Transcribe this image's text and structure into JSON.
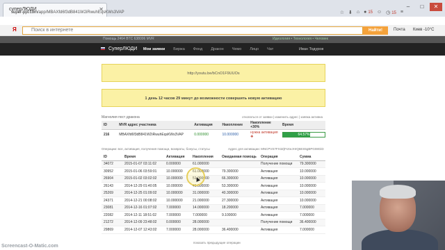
{
  "browser": {
    "tab_title": "суперЛЮДИ",
    "url_host": "super-ppl.com",
    "url_path": "/app/MBAXfd6f3dB841W2iRwuhEqsKWs3VAP",
    "notification_count": "15",
    "clock": "15",
    "search_placeholder": "Поиск в интернете",
    "search_button": "Найти!",
    "mail_link": "Почта",
    "city_link": "Киев -10°C"
  },
  "app": {
    "info_left": "Помощь  2464 BTC  638006 MVR",
    "info_right": "Идеология • Технология • Человек",
    "brand": "СуперЛЮДИ",
    "nav": [
      "Мои заявки",
      "Биржа",
      "Фонд",
      "Дракон",
      "Чемо",
      "Лицо",
      "Чат"
    ],
    "user": "Иван Тодуров"
  },
  "notices": {
    "link": "http://youtu.be/bCnO1F9UUOs",
    "timer": "1 день 12 часов 29 минут до возможности совершить новую активацию"
  },
  "stats": {
    "title": "Магнолия пост дракона",
    "links": "откопаться от заявки | изменить адрес | заявка активна",
    "headers": [
      "ID",
      "MVR адрес участника",
      "Активация",
      "Накопление",
      "Накопление +30%",
      "Время"
    ],
    "row": {
      "id": "216",
      "address": "MBAXfd6f3dB841W2iRwuhEqsKWs3VAP",
      "activation": "0.000000",
      "accumulation": "10.000000",
      "status": "нужна активация",
      "time_pct": "64.57%",
      "time_fill": 64.57
    }
  },
  "ops": {
    "filter": "Операции: все, активация, получения помощи, возвраты, бонусы, статусы",
    "activation_address": "Адрес для активации: MNCPVS7FX3ZjFsXeJHrQ6ES5gBPG08GiD",
    "headers": [
      "ID",
      "Время",
      "Активация",
      "Накопления",
      "Ожидаемая помощь",
      "Операция",
      "Сумма"
    ],
    "rows": [
      [
        "34072",
        "2015-01-07 03:11:02",
        "0.000000",
        "61.000000",
        "",
        "Получение помощи",
        "79.300000"
      ],
      [
        "30952",
        "2015-01-06 03:59:01",
        "10.000000",
        "61.000000",
        "79.300000",
        "Активация",
        "10.000000"
      ],
      [
        "26904",
        "2015-01-02 03:02:02",
        "10.000000",
        "51.000000",
        "66.300000",
        "Активация",
        "10.000000"
      ],
      [
        "26143",
        "2014-12-29 01:40:05",
        "10.000000",
        "41.000000",
        "53.300000",
        "Активация",
        "10.000000"
      ],
      [
        "25269",
        "2014-12-25 01:09:02",
        "10.000000",
        "31.000000",
        "40.300000",
        "Активация",
        "10.000000"
      ],
      [
        "24371",
        "2014-12-21 00:08:02",
        "10.000000",
        "21.000000",
        "27.300000",
        "Активация",
        "10.000000"
      ],
      [
        "23081",
        "2014-12-16 01:07:02",
        "7.000000",
        "14.000000",
        "18.200000",
        "Активация",
        "7.000000"
      ],
      [
        "22082",
        "2014-12-11 18:51:02",
        "7.000000",
        "7.000000",
        "9.100000",
        "Активация",
        "7.000000"
      ],
      [
        "21272",
        "2014-12-09 23:48:02",
        "0.000000",
        "28.000000",
        "",
        "Получение помощи",
        "36.400000"
      ],
      [
        "29869",
        "2014-12-07 12:43:02",
        "7.000000",
        "28.000000",
        "36.400000",
        "Активация",
        "7.000000"
      ]
    ],
    "footer": "показать предыдущие операции"
  },
  "watermark": "Screencast-O-Matic.com"
}
